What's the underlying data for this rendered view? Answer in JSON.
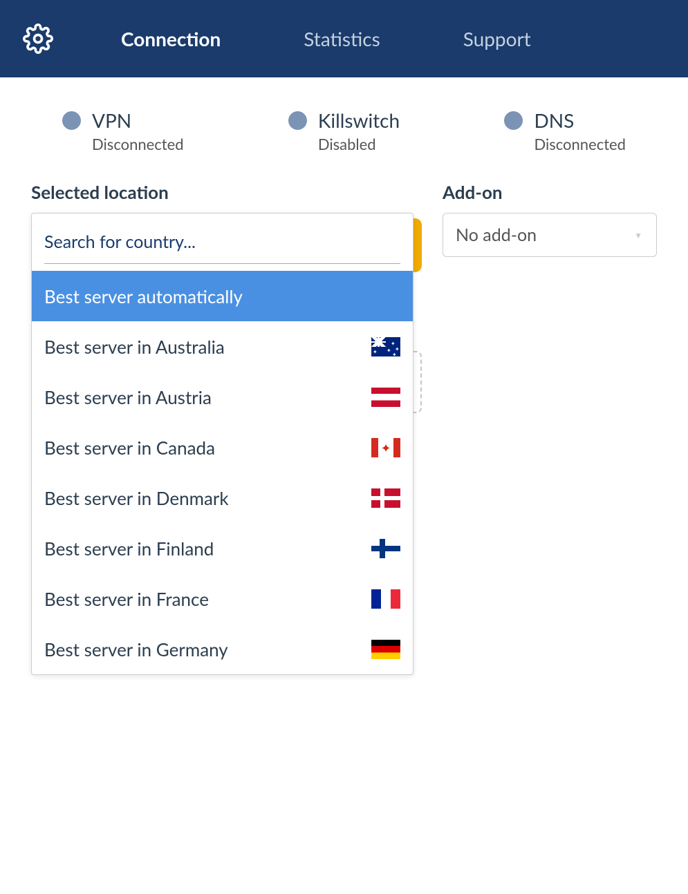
{
  "header": {
    "tabs": [
      {
        "label": "Connection",
        "active": true
      },
      {
        "label": "Statistics",
        "active": false
      },
      {
        "label": "Support",
        "active": false
      }
    ]
  },
  "status": {
    "vpn": {
      "title": "VPN",
      "sub": "Disconnected"
    },
    "killswitch": {
      "title": "Killswitch",
      "sub": "Disabled"
    },
    "dns": {
      "title": "DNS",
      "sub": "Disconnected"
    }
  },
  "location": {
    "label": "Selected location",
    "search_placeholder": "Search for country...",
    "options": [
      {
        "label": "Best server automatically",
        "flag": null,
        "highlighted": true
      },
      {
        "label": "Best server in Australia",
        "flag": "au"
      },
      {
        "label": "Best server in Austria",
        "flag": "at"
      },
      {
        "label": "Best server in Canada",
        "flag": "ca"
      },
      {
        "label": "Best server in Denmark",
        "flag": "dk"
      },
      {
        "label": "Best server in Finland",
        "flag": "fi"
      },
      {
        "label": "Best server in France",
        "flag": "fr"
      },
      {
        "label": "Best server in Germany",
        "flag": "de"
      }
    ]
  },
  "addon": {
    "label": "Add-on",
    "selected": "No add-on"
  }
}
